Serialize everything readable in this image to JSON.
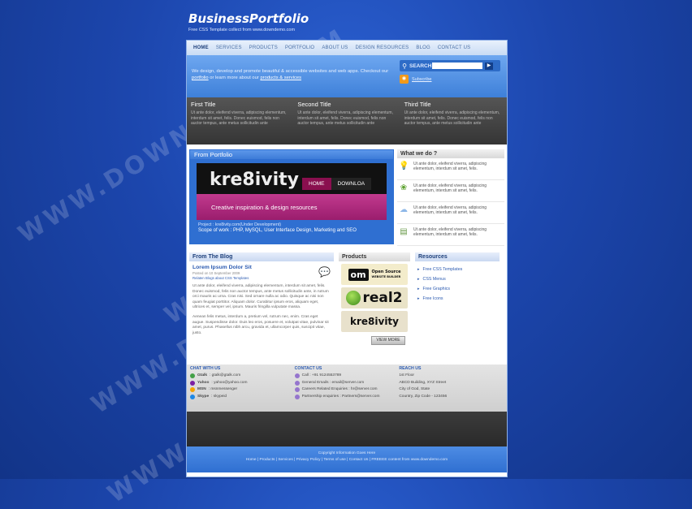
{
  "brand": {
    "logo": "BusinessPortfolio",
    "tagline": "Free CSS Template collect from www.downdemo.com"
  },
  "nav": [
    "HOME",
    "SERVICES",
    "PRODUCTS",
    "PORTFOLIO",
    "ABOUT US",
    "DESIGN RESOURCES",
    "BLOG",
    "CONTACT US"
  ],
  "hero": {
    "intro_1": "We design, develop and promote beautiful & accessible websites and web apps. Checkout our ",
    "intro_link1": "portfolio",
    "intro_2": " or learn more about our ",
    "intro_link2": "products & services",
    "search_label": "SEARCH",
    "search_go": "▶",
    "subscribe": "Subscribe"
  },
  "highlights": [
    {
      "title": "First Title",
      "text": "Ut ante dolor, eleifend viverra, adipiscing elementum, interdum sit amet, felis. Donec euismod, felis non auctor tempus, ante metus sollicitudin ante"
    },
    {
      "title": "Second Title",
      "text": "Ut ante dolor, eleifend viverra, adipiscing elementum, interdum sit amet, felis. Donec euismod, felis non auctor tempus, ante metus sollicitudin ante"
    },
    {
      "title": "Third Title",
      "text": "Ut ante dolor, eleifend viverra, adipiscing elementum, interdum sit amet, felis. Donec euismod, felis non auctor tempus, ante metus sollicitudin ante"
    }
  ],
  "portfolio": {
    "heading": "From Portfolio",
    "site_logo": "kre8ivity",
    "tab_home": "HOME",
    "tab_download": "DOWNLOA",
    "creative": "Creative inspiration & design resources",
    "project": "Project : kre8ivity.com(Under Development)",
    "scope": "Scope of work : PHP, MySQL, User Interface Design, Marketing and SEO"
  },
  "what_we_do": {
    "heading": "What we do ?",
    "items": [
      {
        "icon": "lightbulb-icon",
        "text": "Ut ante dolor, eleifend viverra, adipiscing elementum, interdum sit amet, felis."
      },
      {
        "icon": "butterfly-icon",
        "text": "Ut ante dolor, eleifend viverra, adipiscing elementum, interdum sit amet, felis."
      },
      {
        "icon": "cloud-icon",
        "text": "Ut ante dolor, eleifend viverra, adipiscing elementum, interdum sit amet, felis."
      },
      {
        "icon": "money-icon",
        "text": "Ut ante dolor, eleifend viverra, adipiscing elementum, interdum sit amet, felis."
      }
    ]
  },
  "blog": {
    "heading": "From The Blog",
    "title": "Lorem Ipsum Dolor Sit",
    "posted": "Posted on 10 September 2009",
    "related": "Relaten Blogs about CSS Templates",
    "para1": "Ut ante dolor, eleifend viverra, adipiscing elementum, interdum sit amet, felis. Donec euismod, felis non auctor tempus, ante metus sollicitudin ante, in rutrum orci mauris ac urna. Cras nisi. Sed ornare nulla ac odio. Quisque ac nisi non quam feugiat porttitor. Aliquam dolor. Curabitur ipsum eros, aliquam eget, ultrices et, semper vel, ipsum. Mauris fringilla vulputate massa.",
    "para2": "Aenean felis metus, interdum a, pretium vel, rutrum nec, enim. Cras eget augue. Suspendisse dolor. Duis leo eros, posuere et, volutpat vitae, pulvinar sit amet, purus. Phasellus nibh arcu, gravida et, ullamcorper quis, suscipit vitae, justo."
  },
  "products": {
    "heading": "Products",
    "om": "om",
    "om_text1": "Open Source",
    "om_text2": "WEBSITE BUILDER",
    "real2": "real2",
    "kre": "kre8ivity",
    "view_more": "VIEW MORE"
  },
  "resources": {
    "heading": "Resources",
    "items": [
      "Free CSS Templates",
      "CSS Menus",
      "Free Graphics",
      "Free Icons"
    ]
  },
  "footer": {
    "chat_heading": "CHAT WITH US",
    "chat": [
      {
        "name": "Gtalk",
        "value": " : gtalk@gtalk.com",
        "color": "#43a047"
      },
      {
        "name": "Yahoo",
        "value": " : yahoo@yahoo.com",
        "color": "#7b1fa2"
      },
      {
        "name": "MSN",
        "value": " : msnmessenger",
        "color": "#f4a300"
      },
      {
        "name": "Skype",
        "value": " : skypeid",
        "color": "#1e88e5"
      }
    ],
    "contact_heading": "CONTACT US",
    "contact": [
      "Call : +91 9124553789",
      "General Emails : email@server.com",
      "Careers Related Enquiries : hr@server.com",
      "Partnership enquiries : Partners@server.com"
    ],
    "reach_heading": "REACH US",
    "address": [
      "1st Floor",
      "ABCD Building, XYZ Street",
      "City of God, State",
      "Country, Zip Code - 123456"
    ],
    "copyright": "Copyright Information Goes Here",
    "links": "Home | Products | Services | Privacy Policy | Terms of use | Contact Us | FREEEE content from www.downdemo.com"
  },
  "watermark": "WWW.DOWNDEMO.COM"
}
